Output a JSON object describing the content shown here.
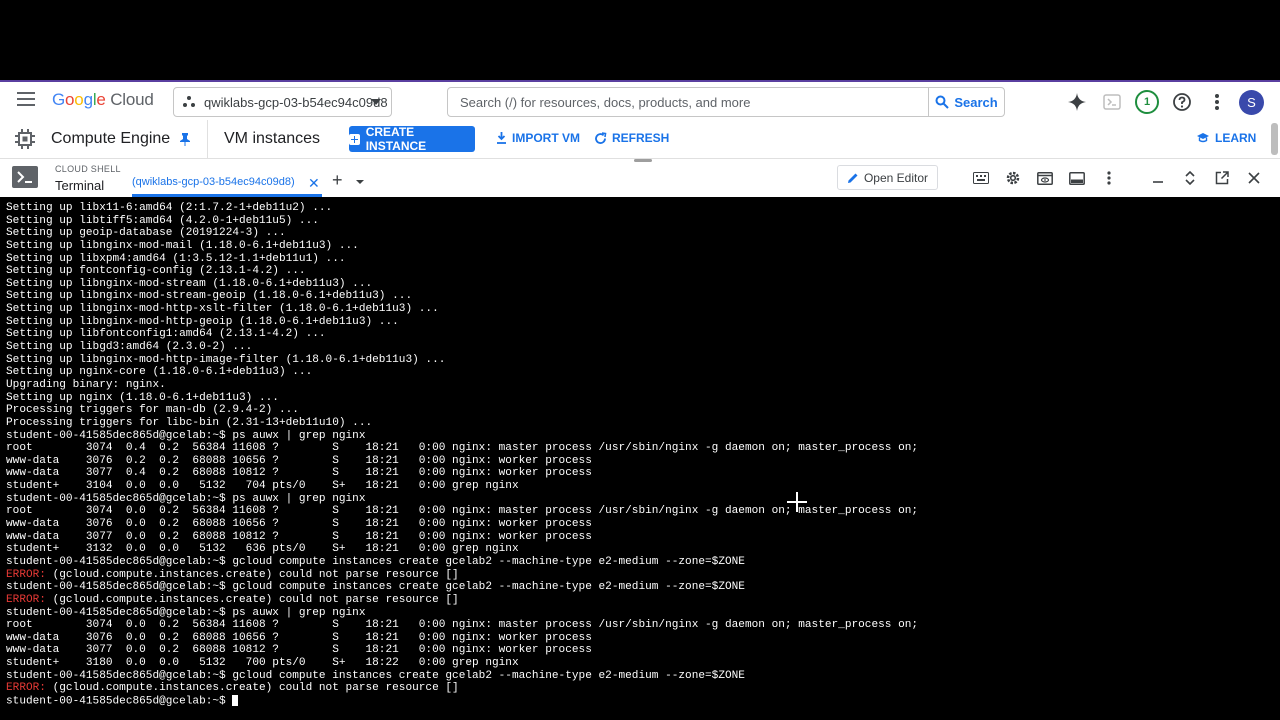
{
  "header": {
    "logo_google": [
      "G",
      "o",
      "o",
      "g",
      "l",
      "e"
    ],
    "logo_cloud": "Cloud",
    "project": "qwiklabs-gcp-03-b54ec94c09d8",
    "search_placeholder": "Search (/) for resources, docs, products, and more",
    "search_button": "Search",
    "notification_count": "1",
    "avatar_letter": "S"
  },
  "product_bar": {
    "product": "Compute Engine",
    "page": "VM instances",
    "create_instance": "CREATE INSTANCE",
    "import_vm": "IMPORT VM",
    "refresh": "REFRESH",
    "learn": "LEARN"
  },
  "cloud_shell": {
    "label": "CLOUD SHELL",
    "terminal_label": "Terminal",
    "tab": "(qwiklabs-gcp-03-b54ec94c09d8)",
    "open_editor": "Open Editor"
  },
  "colors": {
    "accent": "#1a73e8",
    "error": "#e53935",
    "terminal_bg": "#000000"
  },
  "terminal": {
    "lines": [
      {
        "text": "Setting up libx11-6:amd64 (2:1.7.2-1+deb11u2) ..."
      },
      {
        "text": "Setting up libtiff5:amd64 (4.2.0-1+deb11u5) ..."
      },
      {
        "text": "Setting up geoip-database (20191224-3) ..."
      },
      {
        "text": "Setting up libnginx-mod-mail (1.18.0-6.1+deb11u3) ..."
      },
      {
        "text": "Setting up libxpm4:amd64 (1:3.5.12-1.1+deb11u1) ..."
      },
      {
        "text": "Setting up fontconfig-config (2.13.1-4.2) ..."
      },
      {
        "text": "Setting up libnginx-mod-stream (1.18.0-6.1+deb11u3) ..."
      },
      {
        "text": "Setting up libnginx-mod-stream-geoip (1.18.0-6.1+deb11u3) ..."
      },
      {
        "text": "Setting up libnginx-mod-http-xslt-filter (1.18.0-6.1+deb11u3) ..."
      },
      {
        "text": "Setting up libnginx-mod-http-geoip (1.18.0-6.1+deb11u3) ..."
      },
      {
        "text": "Setting up libfontconfig1:amd64 (2.13.1-4.2) ..."
      },
      {
        "text": "Setting up libgd3:amd64 (2.3.0-2) ..."
      },
      {
        "text": "Setting up libnginx-mod-http-image-filter (1.18.0-6.1+deb11u3) ..."
      },
      {
        "text": "Setting up nginx-core (1.18.0-6.1+deb11u3) ..."
      },
      {
        "text": "Upgrading binary: nginx."
      },
      {
        "text": "Setting up nginx (1.18.0-6.1+deb11u3) ..."
      },
      {
        "text": "Processing triggers for man-db (2.9.4-2) ..."
      },
      {
        "text": "Processing triggers for libc-bin (2.31-13+deb11u10) ..."
      },
      {
        "text": "student-00-41585dec865d@gcelab:~$ ps auwx | grep nginx"
      },
      {
        "text": "root        3074  0.4  0.2  56384 11608 ?        S    18:21   0:00 nginx: master process /usr/sbin/nginx -g daemon on; master_process on;"
      },
      {
        "text": "www-data    3076  0.2  0.2  68088 10656 ?        S    18:21   0:00 nginx: worker process"
      },
      {
        "text": "www-data    3077  0.4  0.2  68088 10812 ?        S    18:21   0:00 nginx: worker process"
      },
      {
        "text": "student+    3104  0.0  0.0   5132   704 pts/0    S+   18:21   0:00 grep nginx"
      },
      {
        "text": "student-00-41585dec865d@gcelab:~$ ps auwx | grep nginx"
      },
      {
        "text": "root        3074  0.0  0.2  56384 11608 ?        S    18:21   0:00 nginx: master process /usr/sbin/nginx -g daemon on; master_process on;"
      },
      {
        "text": "www-data    3076  0.0  0.2  68088 10656 ?        S    18:21   0:00 nginx: worker process"
      },
      {
        "text": "www-data    3077  0.0  0.2  68088 10812 ?        S    18:21   0:00 nginx: worker process"
      },
      {
        "text": "student+    3132  0.0  0.0   5132   636 pts/0    S+   18:21   0:00 grep nginx"
      },
      {
        "text": "student-00-41585dec865d@gcelab:~$ gcloud compute instances create gcelab2 --machine-type e2-medium --zone=$ZONE"
      },
      {
        "err": "ERROR:",
        "text": " (gcloud.compute.instances.create) could not parse resource []"
      },
      {
        "text": "student-00-41585dec865d@gcelab:~$ gcloud compute instances create gcelab2 --machine-type e2-medium --zone=$ZONE"
      },
      {
        "err": "ERROR:",
        "text": " (gcloud.compute.instances.create) could not parse resource []"
      },
      {
        "text": "student-00-41585dec865d@gcelab:~$ ps auwx | grep nginx"
      },
      {
        "text": "root        3074  0.0  0.2  56384 11608 ?        S    18:21   0:00 nginx: master process /usr/sbin/nginx -g daemon on; master_process on;"
      },
      {
        "text": "www-data    3076  0.0  0.2  68088 10656 ?        S    18:21   0:00 nginx: worker process"
      },
      {
        "text": "www-data    3077  0.0  0.2  68088 10812 ?        S    18:21   0:00 nginx: worker process"
      },
      {
        "text": "student+    3180  0.0  0.0   5132   700 pts/0    S+   18:22   0:00 grep nginx"
      },
      {
        "text": "student-00-41585dec865d@gcelab:~$ gcloud compute instances create gcelab2 --machine-type e2-medium --zone=$ZONE"
      },
      {
        "err": "ERROR:",
        "text": " (gcloud.compute.instances.create) could not parse resource []"
      },
      {
        "text": "student-00-41585dec865d@gcelab:~$ ",
        "cursor": true
      }
    ]
  }
}
